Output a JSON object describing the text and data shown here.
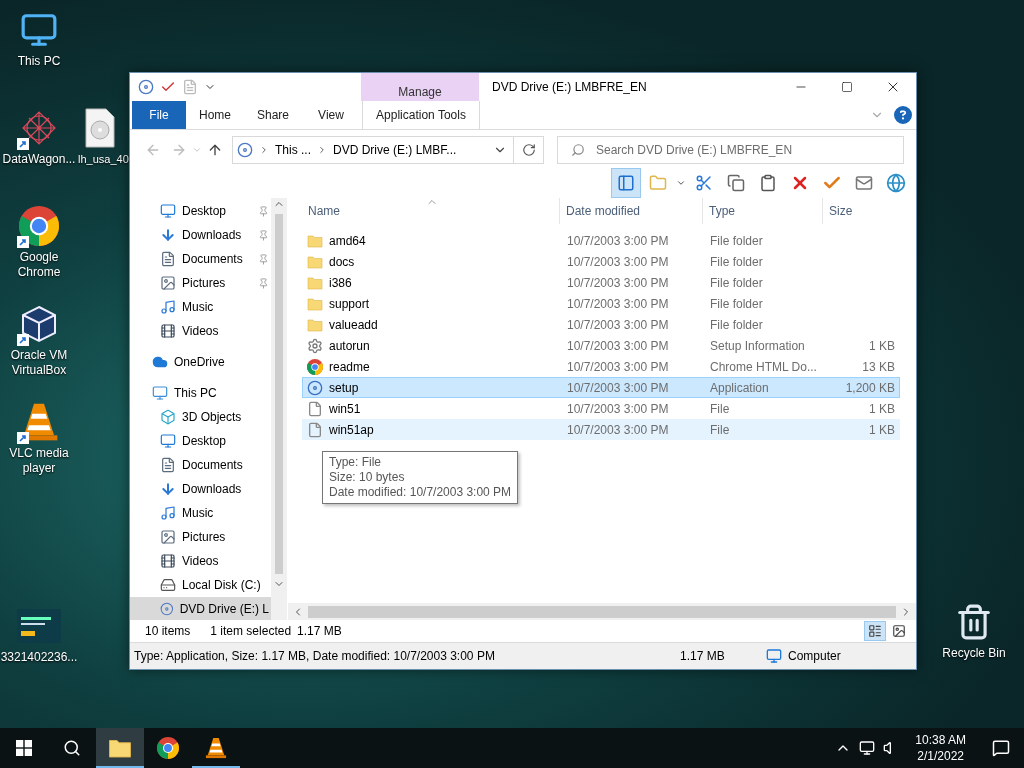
{
  "desktop_icons": [
    {
      "label": "This PC",
      "kind": "pc",
      "shortcut": false
    },
    {
      "label": "DataWagon...",
      "kind": "net",
      "shortcut": true
    },
    {
      "label": "lh_usa_40",
      "kind": "disc",
      "shortcut": false
    },
    {
      "label": "Google Chrome",
      "kind": "chrome",
      "shortcut": true
    },
    {
      "label": "Oracle VM VirtualBox",
      "kind": "vbox",
      "shortcut": true
    },
    {
      "label": "VLC media player",
      "kind": "vlc",
      "shortcut": true
    },
    {
      "label": "3321402236...",
      "kind": "image",
      "shortcut": false
    },
    {
      "label": "Recycle Bin",
      "kind": "bin",
      "shortcut": false
    }
  ],
  "explorer": {
    "title": "DVD Drive (E:) LMBFRE_EN",
    "context_group": "Manage",
    "ribbon_tabs": [
      {
        "label": "File",
        "kind": "file",
        "selected": false
      },
      {
        "label": "Home",
        "kind": "tab",
        "selected": false
      },
      {
        "label": "Share",
        "kind": "tab",
        "selected": false
      },
      {
        "label": "View",
        "kind": "tab",
        "selected": false
      },
      {
        "label": "Application Tools",
        "kind": "context",
        "selected": false
      }
    ],
    "address": {
      "crumbs": [
        "This ...",
        "DVD Drive (E:) LMBF..."
      ]
    },
    "search": {
      "placeholder": "Search DVD Drive (E:) LMBFRE_EN"
    },
    "nav_pane": {
      "quick_access": [
        {
          "label": "Desktop",
          "kind": "desktop",
          "pinned": true
        },
        {
          "label": "Downloads",
          "kind": "downloads",
          "pinned": true
        },
        {
          "label": "Documents",
          "kind": "documents",
          "pinned": true
        },
        {
          "label": "Pictures",
          "kind": "pictures",
          "pinned": true
        },
        {
          "label": "Music",
          "kind": "music",
          "pinned": false
        },
        {
          "label": "Videos",
          "kind": "videos",
          "pinned": false
        }
      ],
      "items": [
        {
          "label": "OneDrive",
          "kind": "onedrive",
          "selected": false
        },
        {
          "label": "This PC",
          "kind": "pc",
          "selected": false,
          "children": [
            {
              "label": "3D Objects",
              "kind": "objects",
              "selected": false
            },
            {
              "label": "Desktop",
              "kind": "desktop",
              "selected": false
            },
            {
              "label": "Documents",
              "kind": "documents",
              "selected": false
            },
            {
              "label": "Downloads",
              "kind": "downloads",
              "selected": false
            },
            {
              "label": "Music",
              "kind": "music",
              "selected": false
            },
            {
              "label": "Pictures",
              "kind": "pictures",
              "selected": false
            },
            {
              "label": "Videos",
              "kind": "videos",
              "selected": false
            },
            {
              "label": "Local Disk (C:)",
              "kind": "disk",
              "selected": false
            },
            {
              "label": "DVD Drive (E:) L",
              "kind": "dvd",
              "selected": true
            }
          ]
        }
      ]
    },
    "columns": [
      "Name",
      "Date modified",
      "Type",
      "Size"
    ],
    "rows": [
      {
        "name": "amd64",
        "date": "10/7/2003 3:00 PM",
        "type": "File folder",
        "size": "",
        "kind": "folder",
        "selected": false,
        "hovered": false
      },
      {
        "name": "docs",
        "date": "10/7/2003 3:00 PM",
        "type": "File folder",
        "size": "",
        "kind": "folder",
        "selected": false,
        "hovered": false
      },
      {
        "name": "i386",
        "date": "10/7/2003 3:00 PM",
        "type": "File folder",
        "size": "",
        "kind": "folder",
        "selected": false,
        "hovered": false
      },
      {
        "name": "support",
        "date": "10/7/2003 3:00 PM",
        "type": "File folder",
        "size": "",
        "kind": "folder",
        "selected": false,
        "hovered": false
      },
      {
        "name": "valueadd",
        "date": "10/7/2003 3:00 PM",
        "type": "File folder",
        "size": "",
        "kind": "folder",
        "selected": false,
        "hovered": false
      },
      {
        "name": "autorun",
        "date": "10/7/2003 3:00 PM",
        "type": "Setup Information",
        "size": "1 KB",
        "kind": "settings",
        "selected": false,
        "hovered": false
      },
      {
        "name": "readme",
        "date": "10/7/2003 3:00 PM",
        "type": "Chrome HTML Do...",
        "size": "13 KB",
        "kind": "chrome",
        "selected": false,
        "hovered": false
      },
      {
        "name": "setup",
        "date": "10/7/2003 3:00 PM",
        "type": "Application",
        "size": "1,200 KB",
        "kind": "app",
        "selected": true,
        "hovered": false
      },
      {
        "name": "win51",
        "date": "10/7/2003 3:00 PM",
        "type": "File",
        "size": "1 KB",
        "kind": "file",
        "selected": false,
        "hovered": false
      },
      {
        "name": "win51ap",
        "date": "10/7/2003 3:00 PM",
        "type": "File",
        "size": "1 KB",
        "kind": "file",
        "selected": false,
        "hovered": true
      }
    ],
    "tooltip": [
      "Type: File",
      "Size: 10 bytes",
      "Date modified: 10/7/2003 3:00 PM"
    ],
    "status": {
      "item_count": "10 items",
      "selection": "1 item selected",
      "selection_size": "1.17 MB"
    },
    "view_modes": [
      {
        "kind": "details",
        "selected": true
      },
      {
        "kind": "tiles",
        "selected": false
      }
    ],
    "details_bar": {
      "summary": "Type: Application, Size: 1.17 MB, Date modified: 10/7/2003 3:00 PM",
      "size": "1.17 MB",
      "zone": "Computer"
    }
  },
  "taskbar": {
    "apps": [
      {
        "kind": "explorer",
        "selected": true,
        "running": true
      },
      {
        "kind": "chrome",
        "selected": false,
        "running": false
      },
      {
        "kind": "vlc",
        "selected": false,
        "running": true
      }
    ],
    "time": "10:38 AM",
    "date": "2/1/2022"
  }
}
